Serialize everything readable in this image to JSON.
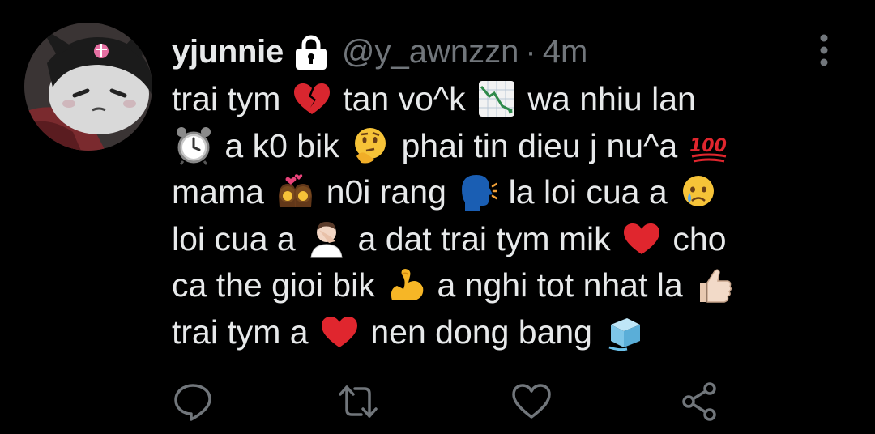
{
  "user": {
    "display_name": "yjunnie",
    "handle": "@y_awnzzn",
    "separator": "·",
    "time": "4m",
    "protected_icon": "lock-icon",
    "avatar_icon": "kuromi-avatar"
  },
  "tweet": {
    "lines": [
      [
        {
          "t": "trai tym "
        },
        {
          "e": "broken-heart"
        },
        {
          "t": " tan vo^k "
        },
        {
          "e": "chart-decreasing"
        },
        {
          "t": " wa nhiu lan"
        }
      ],
      [
        {
          "e": "alarm-clock"
        },
        {
          "t": " a k0 bik "
        },
        {
          "e": "thinking-face"
        },
        {
          "t": " phai tin dieu j nu^a "
        },
        {
          "e": "hundred-points"
        }
      ],
      [
        {
          "t": "mama "
        },
        {
          "e": "kiss-women"
        },
        {
          "t": " n0i rang "
        },
        {
          "e": "speaking-head"
        },
        {
          "t": " la loi cua a "
        },
        {
          "e": "crying-face"
        }
      ],
      [
        {
          "t": "loi cua a "
        },
        {
          "e": "facepalm"
        },
        {
          "t": " a dat trai tym mik "
        },
        {
          "e": "red-heart"
        },
        {
          "t": " cho"
        }
      ],
      [
        {
          "t": "ca the gioi bik "
        },
        {
          "e": "flexed-biceps"
        },
        {
          "t": " a nghi tot nhat la "
        },
        {
          "e": "thumbs-up"
        }
      ],
      [
        {
          "t": "trai tym a "
        },
        {
          "e": "red-heart"
        },
        {
          "t": " nen dong bang "
        },
        {
          "e": "ice-cube"
        }
      ]
    ]
  },
  "actions": [
    {
      "name": "reply-button",
      "icon": "reply-icon"
    },
    {
      "name": "retweet-button",
      "icon": "retweet-icon"
    },
    {
      "name": "like-button",
      "icon": "heart-icon"
    },
    {
      "name": "share-button",
      "icon": "share-icon"
    }
  ],
  "colors": {
    "background": "#000000",
    "text": "#e7e9ea",
    "secondary": "#71767b",
    "red": "#e0262e"
  }
}
